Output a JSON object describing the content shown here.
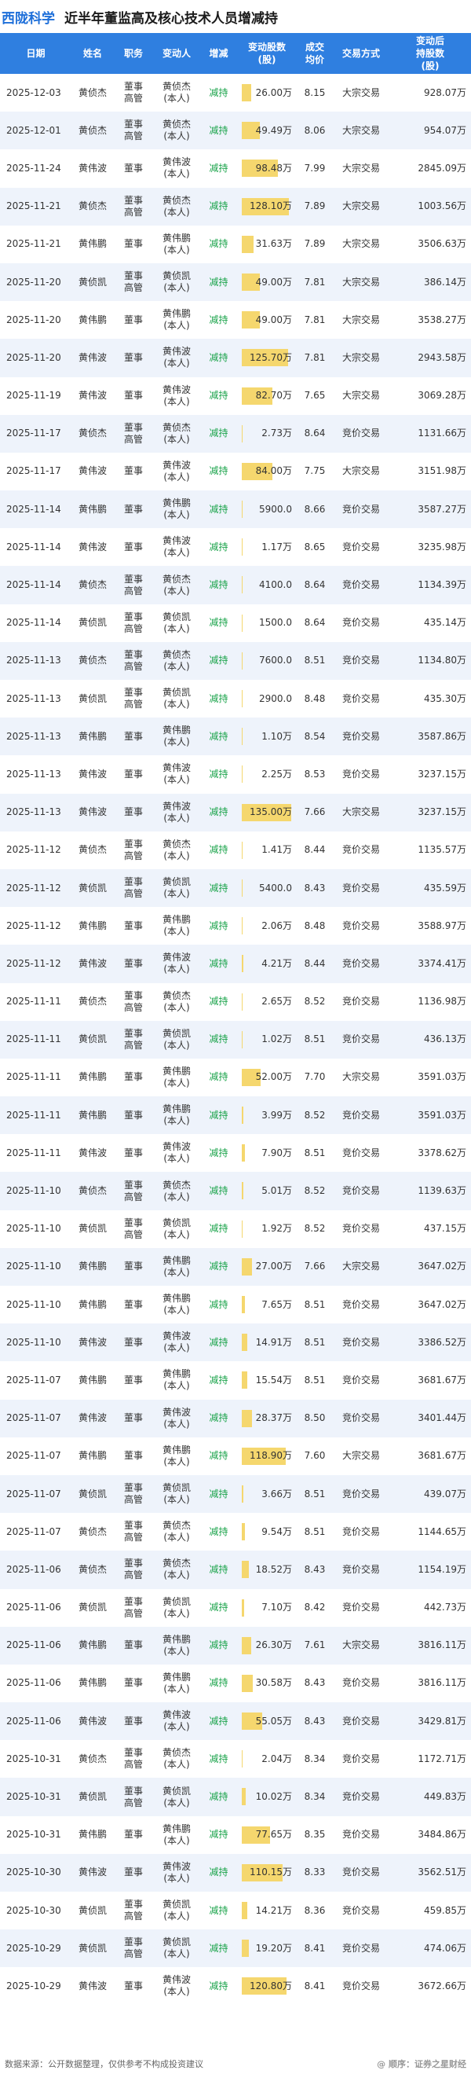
{
  "header": {
    "company": "西陇科学",
    "title": "近半年董监高及核心技术人员增减持"
  },
  "columns": {
    "date": "日期",
    "name": "姓名",
    "position": "职务",
    "changer": "变动人",
    "action": "增减",
    "shares": "变动股数\n(股)",
    "price": "成交\n均价",
    "method": "交易方式",
    "after": "变动后\n持股数\n(股)"
  },
  "bar_max": 128.1,
  "rows": [
    {
      "date": "2025-12-03",
      "name": "黄侦杰",
      "pos": "董事\n高管",
      "changer": "黄侦杰\n(本人)",
      "action": "减持",
      "shares": "26.00万",
      "amt": 26.0,
      "price": "8.15",
      "method": "大宗交易",
      "after": "928.07万"
    },
    {
      "date": "2025-12-01",
      "name": "黄侦杰",
      "pos": "董事\n高管",
      "changer": "黄侦杰\n(本人)",
      "action": "减持",
      "shares": "49.49万",
      "amt": 49.49,
      "price": "8.06",
      "method": "大宗交易",
      "after": "954.07万"
    },
    {
      "date": "2025-11-24",
      "name": "黄伟波",
      "pos": "董事",
      "changer": "黄伟波\n(本人)",
      "action": "减持",
      "shares": "98.48万",
      "amt": 98.48,
      "price": "7.99",
      "method": "大宗交易",
      "after": "2845.09万"
    },
    {
      "date": "2025-11-21",
      "name": "黄侦杰",
      "pos": "董事\n高管",
      "changer": "黄侦杰\n(本人)",
      "action": "减持",
      "shares": "128.10万",
      "amt": 128.1,
      "price": "7.89",
      "method": "大宗交易",
      "after": "1003.56万"
    },
    {
      "date": "2025-11-21",
      "name": "黄伟鹏",
      "pos": "董事",
      "changer": "黄伟鹏\n(本人)",
      "action": "减持",
      "shares": "31.63万",
      "amt": 31.63,
      "price": "7.89",
      "method": "大宗交易",
      "after": "3506.63万"
    },
    {
      "date": "2025-11-20",
      "name": "黄侦凯",
      "pos": "董事\n高管",
      "changer": "黄侦凯\n(本人)",
      "action": "减持",
      "shares": "49.00万",
      "amt": 49.0,
      "price": "7.81",
      "method": "大宗交易",
      "after": "386.14万"
    },
    {
      "date": "2025-11-20",
      "name": "黄伟鹏",
      "pos": "董事",
      "changer": "黄伟鹏\n(本人)",
      "action": "减持",
      "shares": "49.00万",
      "amt": 49.0,
      "price": "7.81",
      "method": "大宗交易",
      "after": "3538.27万"
    },
    {
      "date": "2025-11-20",
      "name": "黄伟波",
      "pos": "董事",
      "changer": "黄伟波\n(本人)",
      "action": "减持",
      "shares": "125.70万",
      "amt": 125.7,
      "price": "7.81",
      "method": "大宗交易",
      "after": "2943.58万"
    },
    {
      "date": "2025-11-19",
      "name": "黄伟波",
      "pos": "董事",
      "changer": "黄伟波\n(本人)",
      "action": "减持",
      "shares": "82.70万",
      "amt": 82.7,
      "price": "7.65",
      "method": "大宗交易",
      "after": "3069.28万"
    },
    {
      "date": "2025-11-17",
      "name": "黄侦杰",
      "pos": "董事\n高管",
      "changer": "黄侦杰\n(本人)",
      "action": "减持",
      "shares": "2.73万",
      "amt": 2.73,
      "price": "8.64",
      "method": "竞价交易",
      "after": "1131.66万"
    },
    {
      "date": "2025-11-17",
      "name": "黄伟波",
      "pos": "董事",
      "changer": "黄伟波\n(本人)",
      "action": "减持",
      "shares": "84.00万",
      "amt": 84.0,
      "price": "7.75",
      "method": "大宗交易",
      "after": "3151.98万"
    },
    {
      "date": "2025-11-14",
      "name": "黄伟鹏",
      "pos": "董事",
      "changer": "黄伟鹏\n(本人)",
      "action": "减持",
      "shares": "5900.0",
      "amt": 0.59,
      "price": "8.66",
      "method": "竞价交易",
      "after": "3587.27万"
    },
    {
      "date": "2025-11-14",
      "name": "黄伟波",
      "pos": "董事",
      "changer": "黄伟波\n(本人)",
      "action": "减持",
      "shares": "1.17万",
      "amt": 1.17,
      "price": "8.65",
      "method": "竞价交易",
      "after": "3235.98万"
    },
    {
      "date": "2025-11-14",
      "name": "黄侦杰",
      "pos": "董事\n高管",
      "changer": "黄侦杰\n(本人)",
      "action": "减持",
      "shares": "4100.0",
      "amt": 0.41,
      "price": "8.64",
      "method": "竞价交易",
      "after": "1134.39万"
    },
    {
      "date": "2025-11-14",
      "name": "黄侦凯",
      "pos": "董事\n高管",
      "changer": "黄侦凯\n(本人)",
      "action": "减持",
      "shares": "1500.0",
      "amt": 0.15,
      "price": "8.64",
      "method": "竞价交易",
      "after": "435.14万"
    },
    {
      "date": "2025-11-13",
      "name": "黄侦杰",
      "pos": "董事\n高管",
      "changer": "黄侦杰\n(本人)",
      "action": "减持",
      "shares": "7600.0",
      "amt": 0.76,
      "price": "8.51",
      "method": "竞价交易",
      "after": "1134.80万"
    },
    {
      "date": "2025-11-13",
      "name": "黄侦凯",
      "pos": "董事\n高管",
      "changer": "黄侦凯\n(本人)",
      "action": "减持",
      "shares": "2900.0",
      "amt": 0.29,
      "price": "8.48",
      "method": "竞价交易",
      "after": "435.30万"
    },
    {
      "date": "2025-11-13",
      "name": "黄伟鹏",
      "pos": "董事",
      "changer": "黄伟鹏\n(本人)",
      "action": "减持",
      "shares": "1.10万",
      "amt": 1.1,
      "price": "8.54",
      "method": "竞价交易",
      "after": "3587.86万"
    },
    {
      "date": "2025-11-13",
      "name": "黄伟波",
      "pos": "董事",
      "changer": "黄伟波\n(本人)",
      "action": "减持",
      "shares": "2.25万",
      "amt": 2.25,
      "price": "8.53",
      "method": "竞价交易",
      "after": "3237.15万"
    },
    {
      "date": "2025-11-13",
      "name": "黄伟波",
      "pos": "董事",
      "changer": "黄伟波\n(本人)",
      "action": "减持",
      "shares": "135.00万",
      "amt": 135.0,
      "price": "7.66",
      "method": "大宗交易",
      "after": "3237.15万"
    },
    {
      "date": "2025-11-12",
      "name": "黄侦杰",
      "pos": "董事\n高管",
      "changer": "黄侦杰\n(本人)",
      "action": "减持",
      "shares": "1.41万",
      "amt": 1.41,
      "price": "8.44",
      "method": "竞价交易",
      "after": "1135.57万"
    },
    {
      "date": "2025-11-12",
      "name": "黄侦凯",
      "pos": "董事\n高管",
      "changer": "黄侦凯\n(本人)",
      "action": "减持",
      "shares": "5400.0",
      "amt": 0.54,
      "price": "8.43",
      "method": "竞价交易",
      "after": "435.59万"
    },
    {
      "date": "2025-11-12",
      "name": "黄伟鹏",
      "pos": "董事",
      "changer": "黄伟鹏\n(本人)",
      "action": "减持",
      "shares": "2.06万",
      "amt": 2.06,
      "price": "8.48",
      "method": "竞价交易",
      "after": "3588.97万"
    },
    {
      "date": "2025-11-12",
      "name": "黄伟波",
      "pos": "董事",
      "changer": "黄伟波\n(本人)",
      "action": "减持",
      "shares": "4.21万",
      "amt": 4.21,
      "price": "8.44",
      "method": "竞价交易",
      "after": "3374.41万"
    },
    {
      "date": "2025-11-11",
      "name": "黄侦杰",
      "pos": "董事\n高管",
      "changer": "黄侦杰\n(本人)",
      "action": "减持",
      "shares": "2.65万",
      "amt": 2.65,
      "price": "8.52",
      "method": "竞价交易",
      "after": "1136.98万"
    },
    {
      "date": "2025-11-11",
      "name": "黄侦凯",
      "pos": "董事\n高管",
      "changer": "黄侦凯\n(本人)",
      "action": "减持",
      "shares": "1.02万",
      "amt": 1.02,
      "price": "8.51",
      "method": "竞价交易",
      "after": "436.13万"
    },
    {
      "date": "2025-11-11",
      "name": "黄伟鹏",
      "pos": "董事",
      "changer": "黄伟鹏\n(本人)",
      "action": "减持",
      "shares": "52.00万",
      "amt": 52.0,
      "price": "7.70",
      "method": "大宗交易",
      "after": "3591.03万"
    },
    {
      "date": "2025-11-11",
      "name": "黄伟鹏",
      "pos": "董事",
      "changer": "黄伟鹏\n(本人)",
      "action": "减持",
      "shares": "3.99万",
      "amt": 3.99,
      "price": "8.52",
      "method": "竞价交易",
      "after": "3591.03万"
    },
    {
      "date": "2025-11-11",
      "name": "黄伟波",
      "pos": "董事",
      "changer": "黄伟波\n(本人)",
      "action": "减持",
      "shares": "7.90万",
      "amt": 7.9,
      "price": "8.51",
      "method": "竞价交易",
      "after": "3378.62万"
    },
    {
      "date": "2025-11-10",
      "name": "黄侦杰",
      "pos": "董事\n高管",
      "changer": "黄侦杰\n(本人)",
      "action": "减持",
      "shares": "5.01万",
      "amt": 5.01,
      "price": "8.52",
      "method": "竞价交易",
      "after": "1139.63万"
    },
    {
      "date": "2025-11-10",
      "name": "黄侦凯",
      "pos": "董事\n高管",
      "changer": "黄侦凯\n(本人)",
      "action": "减持",
      "shares": "1.92万",
      "amt": 1.92,
      "price": "8.52",
      "method": "竞价交易",
      "after": "437.15万"
    },
    {
      "date": "2025-11-10",
      "name": "黄伟鹏",
      "pos": "董事",
      "changer": "黄伟鹏\n(本人)",
      "action": "减持",
      "shares": "27.00万",
      "amt": 27.0,
      "price": "7.66",
      "method": "大宗交易",
      "after": "3647.02万"
    },
    {
      "date": "2025-11-10",
      "name": "黄伟鹏",
      "pos": "董事",
      "changer": "黄伟鹏\n(本人)",
      "action": "减持",
      "shares": "7.65万",
      "amt": 7.65,
      "price": "8.51",
      "method": "竞价交易",
      "after": "3647.02万"
    },
    {
      "date": "2025-11-10",
      "name": "黄伟波",
      "pos": "董事",
      "changer": "黄伟波\n(本人)",
      "action": "减持",
      "shares": "14.91万",
      "amt": 14.91,
      "price": "8.51",
      "method": "竞价交易",
      "after": "3386.52万"
    },
    {
      "date": "2025-11-07",
      "name": "黄伟鹏",
      "pos": "董事",
      "changer": "黄伟鹏\n(本人)",
      "action": "减持",
      "shares": "15.54万",
      "amt": 15.54,
      "price": "8.51",
      "method": "竞价交易",
      "after": "3681.67万"
    },
    {
      "date": "2025-11-07",
      "name": "黄伟波",
      "pos": "董事",
      "changer": "黄伟波\n(本人)",
      "action": "减持",
      "shares": "28.37万",
      "amt": 28.37,
      "price": "8.50",
      "method": "竞价交易",
      "after": "3401.44万"
    },
    {
      "date": "2025-11-07",
      "name": "黄伟鹏",
      "pos": "董事",
      "changer": "黄伟鹏\n(本人)",
      "action": "减持",
      "shares": "118.90万",
      "amt": 118.9,
      "price": "7.60",
      "method": "大宗交易",
      "after": "3681.67万"
    },
    {
      "date": "2025-11-07",
      "name": "黄侦凯",
      "pos": "董事\n高管",
      "changer": "黄侦凯\n(本人)",
      "action": "减持",
      "shares": "3.66万",
      "amt": 3.66,
      "price": "8.51",
      "method": "竞价交易",
      "after": "439.07万"
    },
    {
      "date": "2025-11-07",
      "name": "黄侦杰",
      "pos": "董事\n高管",
      "changer": "黄侦杰\n(本人)",
      "action": "减持",
      "shares": "9.54万",
      "amt": 9.54,
      "price": "8.51",
      "method": "竞价交易",
      "after": "1144.65万"
    },
    {
      "date": "2025-11-06",
      "name": "黄侦杰",
      "pos": "董事\n高管",
      "changer": "黄侦杰\n(本人)",
      "action": "减持",
      "shares": "18.52万",
      "amt": 18.52,
      "price": "8.43",
      "method": "竞价交易",
      "after": "1154.19万"
    },
    {
      "date": "2025-11-06",
      "name": "黄侦凯",
      "pos": "董事\n高管",
      "changer": "黄侦凯\n(本人)",
      "action": "减持",
      "shares": "7.10万",
      "amt": 7.1,
      "price": "8.42",
      "method": "竞价交易",
      "after": "442.73万"
    },
    {
      "date": "2025-11-06",
      "name": "黄伟鹏",
      "pos": "董事",
      "changer": "黄伟鹏\n(本人)",
      "action": "减持",
      "shares": "26.30万",
      "amt": 26.3,
      "price": "7.61",
      "method": "大宗交易",
      "after": "3816.11万"
    },
    {
      "date": "2025-11-06",
      "name": "黄伟鹏",
      "pos": "董事",
      "changer": "黄伟鹏\n(本人)",
      "action": "减持",
      "shares": "30.58万",
      "amt": 30.58,
      "price": "8.43",
      "method": "竞价交易",
      "after": "3816.11万"
    },
    {
      "date": "2025-11-06",
      "name": "黄伟波",
      "pos": "董事",
      "changer": "黄伟波\n(本人)",
      "action": "减持",
      "shares": "55.05万",
      "amt": 55.05,
      "price": "8.43",
      "method": "竞价交易",
      "after": "3429.81万"
    },
    {
      "date": "2025-10-31",
      "name": "黄侦杰",
      "pos": "董事\n高管",
      "changer": "黄侦杰\n(本人)",
      "action": "减持",
      "shares": "2.04万",
      "amt": 2.04,
      "price": "8.34",
      "method": "竞价交易",
      "after": "1172.71万"
    },
    {
      "date": "2025-10-31",
      "name": "黄侦凯",
      "pos": "董事\n高管",
      "changer": "黄侦凯\n(本人)",
      "action": "减持",
      "shares": "10.02万",
      "amt": 10.02,
      "price": "8.34",
      "method": "竞价交易",
      "after": "449.83万"
    },
    {
      "date": "2025-10-31",
      "name": "黄伟鹏",
      "pos": "董事",
      "changer": "黄伟鹏\n(本人)",
      "action": "减持",
      "shares": "77.65万",
      "amt": 77.65,
      "price": "8.35",
      "method": "竞价交易",
      "after": "3484.86万"
    },
    {
      "date": "2025-10-30",
      "name": "黄伟波",
      "pos": "董事",
      "changer": "黄伟波\n(本人)",
      "action": "减持",
      "shares": "110.15万",
      "amt": 110.15,
      "price": "8.33",
      "method": "竞价交易",
      "after": "3562.51万"
    },
    {
      "date": "2025-10-30",
      "name": "黄侦凯",
      "pos": "董事\n高管",
      "changer": "黄侦凯\n(本人)",
      "action": "减持",
      "shares": "14.21万",
      "amt": 14.21,
      "price": "8.36",
      "method": "竞价交易",
      "after": "459.85万"
    },
    {
      "date": "2025-10-29",
      "name": "黄侦凯",
      "pos": "董事\n高管",
      "changer": "黄侦凯\n(本人)",
      "action": "减持",
      "shares": "19.20万",
      "amt": 19.2,
      "price": "8.41",
      "method": "竞价交易",
      "after": "474.06万"
    },
    {
      "date": "2025-10-29",
      "name": "黄伟波",
      "pos": "董事",
      "changer": "黄伟波\n(本人)",
      "action": "减持",
      "shares": "120.80万",
      "amt": 120.8,
      "price": "8.41",
      "method": "竞价交易",
      "after": "3672.66万"
    }
  ],
  "footer": {
    "source": "数据来源：公开数据整理，仅供参考不构成投资建议",
    "logo": "@ 顺序：证券之星财经"
  },
  "colors": {
    "header_bg": "#2f7fe0",
    "accent_title": "#1e6fd9",
    "bar": "#f5d76e",
    "reduce_text": "#1aa34a",
    "row_alt": "#eef3fb"
  }
}
